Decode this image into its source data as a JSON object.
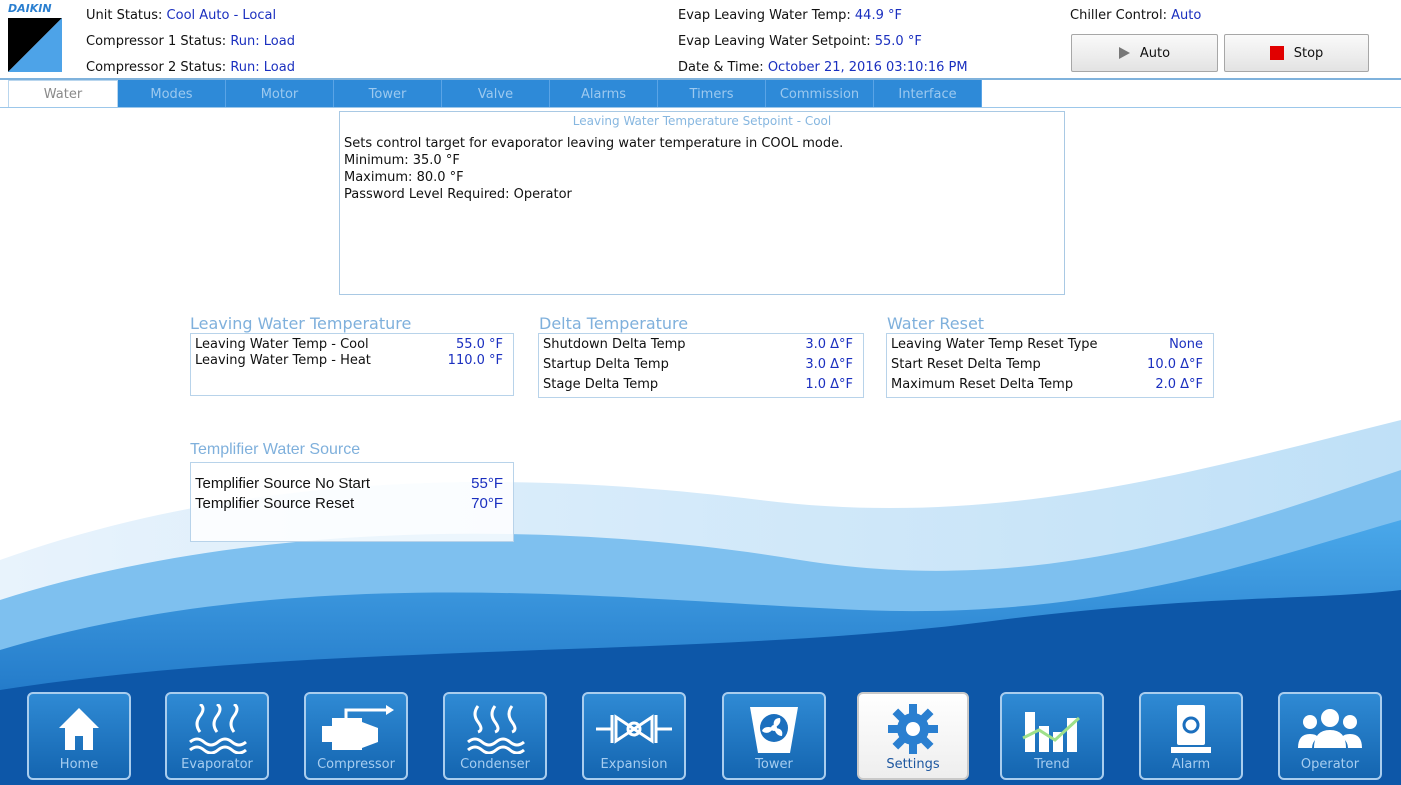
{
  "header": {
    "logo_text": "DAIKIN",
    "unit_status_label": "Unit Status:",
    "unit_status_value": "Cool Auto - Local",
    "comp1_label": "Compressor 1 Status:",
    "comp1_value": "Run: Load",
    "comp2_label": "Compressor 2 Status:",
    "comp2_value": "Run: Load",
    "evap_lwt_label": "Evap Leaving Water Temp:",
    "evap_lwt_value": "44.9 °F",
    "evap_sp_label": "Evap Leaving Water Setpoint:",
    "evap_sp_value": "55.0 °F",
    "datetime_label": "Date & Time:",
    "datetime_value": "October 21, 2016  03:10:16 PM",
    "chiller_control_label": "Chiller Control:",
    "chiller_control_value": "Auto",
    "auto_button": "Auto",
    "stop_button": "Stop"
  },
  "tabs": [
    {
      "label": "Water",
      "active": true
    },
    {
      "label": "Modes"
    },
    {
      "label": "Motor"
    },
    {
      "label": "Tower"
    },
    {
      "label": "Valve"
    },
    {
      "label": "Alarms"
    },
    {
      "label": "Timers"
    },
    {
      "label": "Commission"
    },
    {
      "label": "Interface"
    }
  ],
  "description": {
    "title": "Leaving Water Temperature Setpoint - Cool",
    "line1": "Sets control target for evaporator leaving water temperature in COOL mode.",
    "line2": "Minimum: 35.0 °F",
    "line3": "Maximum: 80.0 °F",
    "line4": "Password Level Required: Operator"
  },
  "groups": {
    "lwt": {
      "title": "Leaving Water Temperature",
      "rows": [
        {
          "label": "Leaving Water Temp - Cool",
          "value": "55.0 °F"
        },
        {
          "label": "Leaving Water Temp  - Heat",
          "value": "110.0 °F"
        }
      ]
    },
    "delta": {
      "title": "Delta Temperature",
      "rows": [
        {
          "label": "Shutdown Delta Temp",
          "value": "3.0 Δ°F"
        },
        {
          "label": "Startup Delta Temp",
          "value": "3.0 Δ°F"
        },
        {
          "label": "Stage Delta Temp",
          "value": "1.0 Δ°F"
        }
      ]
    },
    "reset": {
      "title": "Water Reset",
      "rows": [
        {
          "label": "Leaving Water Temp Reset Type",
          "value": "None"
        },
        {
          "label": "Start Reset Delta Temp",
          "value": "10.0 Δ°F"
        },
        {
          "label": "Maximum Reset Delta Temp",
          "value": "2.0 Δ°F"
        }
      ]
    },
    "templifier": {
      "title": "Templifier Water Source",
      "rows": [
        {
          "label": "Templifier Source No Start",
          "value": "55°F"
        },
        {
          "label": "Templifier Source Reset",
          "value": "70°F"
        }
      ]
    }
  },
  "nav": [
    {
      "label": "Home",
      "icon": "home-icon"
    },
    {
      "label": "Evaporator",
      "icon": "evaporator-icon"
    },
    {
      "label": "Compressor",
      "icon": "compressor-icon"
    },
    {
      "label": "Condenser",
      "icon": "condenser-icon"
    },
    {
      "label": "Expansion",
      "icon": "expansion-valve-icon"
    },
    {
      "label": "Tower",
      "icon": "tower-fan-icon"
    },
    {
      "label": "Settings",
      "icon": "gear-icon",
      "active": true
    },
    {
      "label": "Trend",
      "icon": "trend-chart-icon"
    },
    {
      "label": "Alarm",
      "icon": "alarm-icon"
    },
    {
      "label": "Operator",
      "icon": "users-icon"
    }
  ],
  "colors": {
    "accent_blue": "#2e8ad8",
    "value_blue": "#1a2fbf",
    "stop_red": "#e10000"
  }
}
